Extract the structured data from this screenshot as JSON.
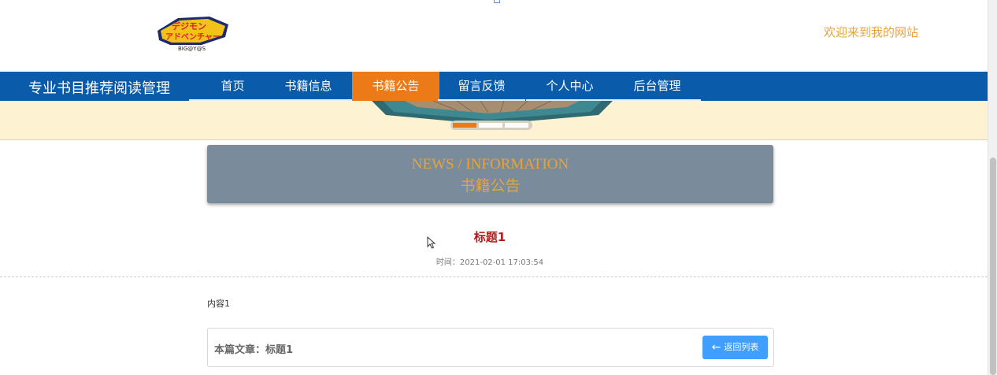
{
  "header": {
    "logo_text": "BIG@Y@S",
    "welcome": "欢迎来到我的网站"
  },
  "nav": {
    "site_title": "专业书目推荐阅读管理",
    "items": [
      {
        "label": "首页",
        "active": false
      },
      {
        "label": "书籍信息",
        "active": false
      },
      {
        "label": "书籍公告",
        "active": true
      },
      {
        "label": "留言反馈",
        "active": false
      },
      {
        "label": "个人中心",
        "active": false
      },
      {
        "label": "后台管理",
        "active": false
      }
    ]
  },
  "banner": {
    "slides": 3,
    "active_slide": 1
  },
  "section": {
    "en_title": "NEWS / INFORMATION",
    "cn_title": "书籍公告"
  },
  "article": {
    "title": "标题1",
    "time": "时间：2021-02-01 17:03:54",
    "content": "内容1"
  },
  "footer": {
    "current_article": "本篇文章：标题1",
    "back_button": "返回列表"
  },
  "colors": {
    "nav_bg": "#0a5cab",
    "active": "#ec7b17",
    "accent_text": "#e8a33c",
    "title_red": "#b81c1c",
    "button_blue": "#409eff"
  }
}
